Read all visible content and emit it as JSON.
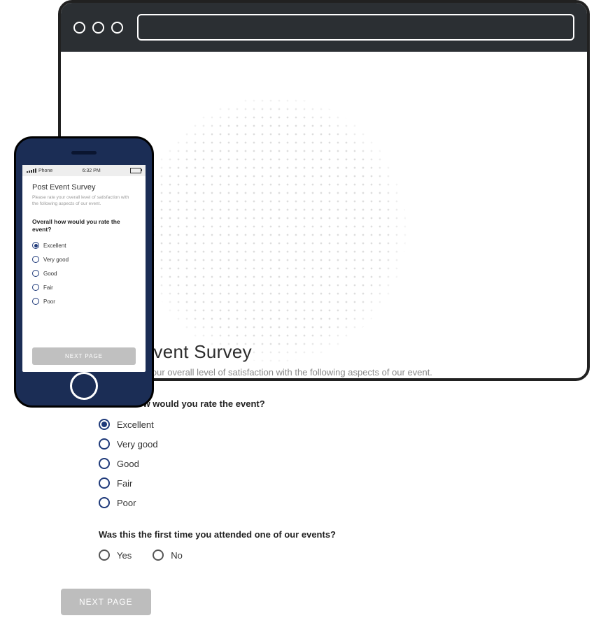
{
  "survey": {
    "title": "Post Event Survey",
    "subtitle": "Please rate your overall level of satisfaction with the following aspects of our event.",
    "q1": {
      "label": "Overall how would you rate the event?",
      "selected": "Excellent",
      "options": [
        "Excellent",
        "Very good",
        "Good",
        "Fair",
        "Poor"
      ]
    },
    "q2": {
      "label": "Was this the first time you attended one of our events?",
      "options": [
        "Yes",
        "No"
      ]
    },
    "next_label": "NEXT PAGE"
  },
  "phone": {
    "statusbar": {
      "carrier": "Phone",
      "time": "6:32 PM"
    }
  },
  "colors": {
    "accent": "#1f3a7a",
    "button": "#bdbdbd"
  }
}
